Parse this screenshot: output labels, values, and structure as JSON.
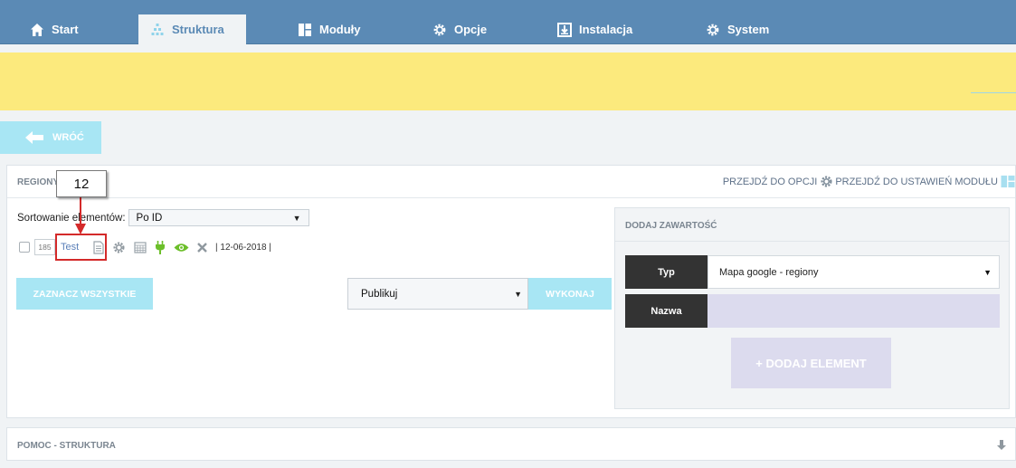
{
  "nav": {
    "tabs": [
      {
        "label": "Start",
        "icon": "home-icon"
      },
      {
        "label": "Struktura",
        "icon": "structure-icon",
        "active": true
      },
      {
        "label": "Moduły",
        "icon": "modules-icon"
      },
      {
        "label": "Opcje",
        "icon": "gear-icon"
      },
      {
        "label": "Instalacja",
        "icon": "install-icon"
      },
      {
        "label": "System",
        "icon": "gear-icon"
      }
    ]
  },
  "back_button": {
    "label": "WRÓĆ",
    "icon": "arrow-left-icon"
  },
  "regions_panel": {
    "title": "REGIONY",
    "link_options": "PRZEJDŹ DO OPCJI",
    "link_module_settings": "PRZEJDŹ DO USTAWIEŃ MODUŁU",
    "sort_label": "Sortowanie elementów:",
    "sort_value": "Po ID",
    "items": [
      {
        "id": "185",
        "name": "Test",
        "date": "| 12-06-2018 |"
      }
    ],
    "select_all_label": "ZAZNACZ WSZYSTKIE",
    "bulk_action_value": "Publikuj",
    "execute_label": "WYKONAJ"
  },
  "annotation": {
    "number": "12",
    "color": "#d42a2a"
  },
  "add_content": {
    "title": "DODAJ ZAWARTOŚĆ",
    "type_label": "Typ",
    "type_value": "Mapa google - regiony",
    "name_label": "Nazwa",
    "name_value": "",
    "add_button": "+ DODAJ ELEMENT"
  },
  "help_panel": {
    "title": "POMOC - STRUKTURA"
  },
  "colors": {
    "nav_bg": "#5b8ab5",
    "banner": "#fcea7d",
    "accent_cyan": "#a8e6f4",
    "link": "#5a7fb8",
    "green": "#6cbf2a"
  }
}
